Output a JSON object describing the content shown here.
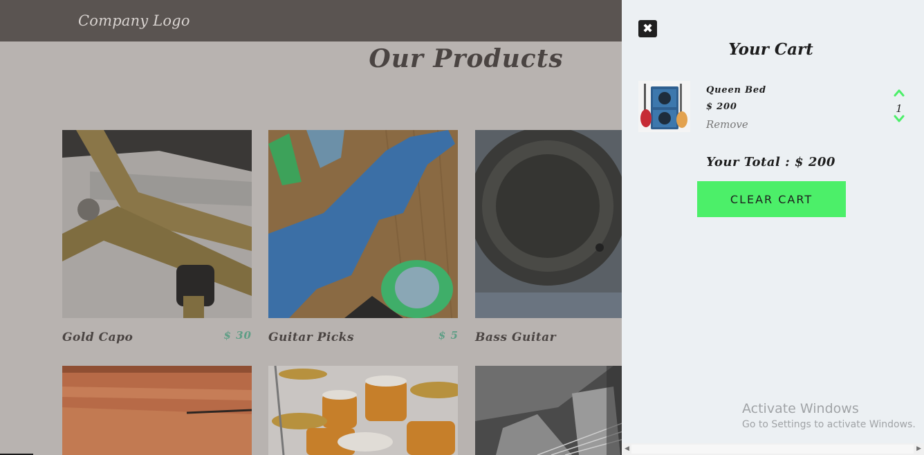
{
  "header": {
    "logo": "Company Logo"
  },
  "main": {
    "title": "Our Products",
    "products": [
      {
        "name": "Gold Capo",
        "price": "$ 30"
      },
      {
        "name": "Guitar Picks",
        "price": "$ 5"
      },
      {
        "name": "Bass Guitar",
        "price": ""
      },
      {
        "name": "",
        "price": ""
      },
      {
        "name": "",
        "price": ""
      },
      {
        "name": "",
        "price": ""
      }
    ]
  },
  "cart": {
    "close_icon": "close-icon",
    "title": "Your Cart",
    "items": [
      {
        "name": "Queen Bed",
        "price": "$ 200",
        "remove_label": "Remove",
        "quantity": "1"
      }
    ],
    "total_label": "Your Total : $ 200",
    "clear_label": "CLEAR CART",
    "accent_color": "#4cef69"
  },
  "watermark": {
    "line1": "Activate Windows",
    "line2": "Go to Settings to activate Windows."
  }
}
